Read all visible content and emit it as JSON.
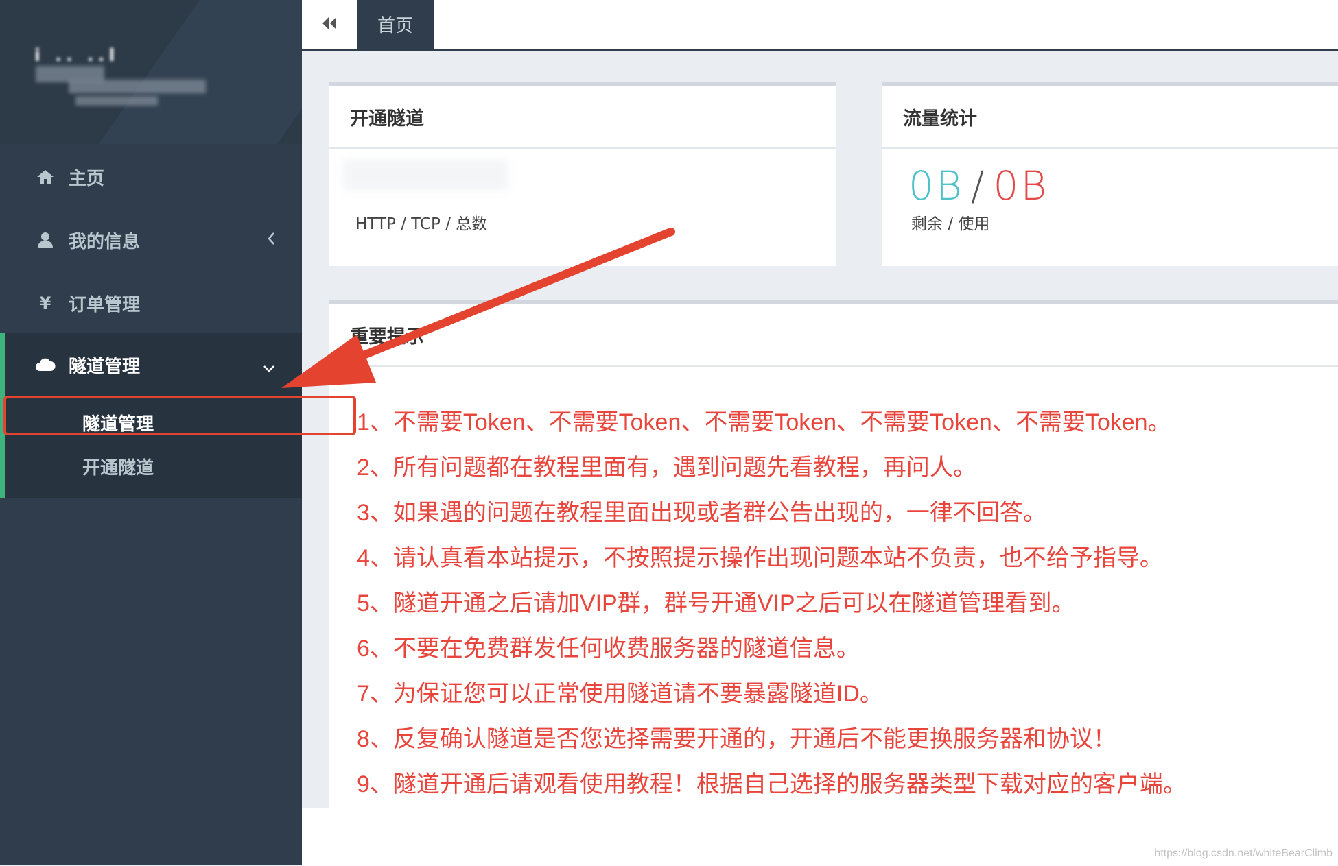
{
  "brand": {
    "text": "i  ..  ..l"
  },
  "sidebar": {
    "items": [
      {
        "label": "主页",
        "icon": "home-icon"
      },
      {
        "label": "我的信息",
        "icon": "user-icon",
        "chevron": "chevron-left-icon"
      },
      {
        "label": "订单管理",
        "icon": "yen-icon",
        "icon_glyph": "¥"
      },
      {
        "label": "隧道管理",
        "icon": "cloud-icon",
        "chevron": "chevron-down-icon"
      }
    ],
    "subitems": [
      {
        "label": "隧道管理"
      },
      {
        "label": "开通隧道"
      }
    ]
  },
  "topbar": {
    "collapse_icon": "double-chevron-left-icon",
    "tab_home": "首页"
  },
  "cards": {
    "tunnel": {
      "title": "开通隧道",
      "caption": "HTTP / TCP / 总数"
    },
    "traffic": {
      "title": "流量统计",
      "remaining": "0B",
      "slash": "/",
      "used": "0B",
      "caption": "剩余 / 使用"
    },
    "notice": {
      "title": "重要提示",
      "lines": [
        "1、不需要Token、不需要Token、不需要Token、不需要Token、不需要Token。",
        "2、所有问题都在教程里面有，遇到问题先看教程，再问人。",
        "3、如果遇的问题在教程里面出现或者群公告出现的，一律不回答。",
        "4、请认真看本站提示，不按照提示操作出现问题本站不负责，也不给予指导。",
        "5、隧道开通之后请加VIP群，群号开通VIP之后可以在隧道管理看到。",
        "6、不要在免费群发任何收费服务器的隧道信息。",
        "7、为保证您可以正常使用隧道请不要暴露隧道ID。",
        "8、反复确认隧道是否您选择需要开通的，开通后不能更换服务器和协议！",
        "9、隧道开通后请观看使用教程！根据自己选择的服务器类型下载对应的客户端。"
      ]
    }
  },
  "colors": {
    "sidebar_bg": "#2f3d4c",
    "active_accent": "#3eb37e",
    "remaining": "#4fc1c9",
    "used": "#e34a4a",
    "notice_text": "#e8453c",
    "annotation": "#e4432f"
  },
  "watermark": "https://blog.csdn.net/whiteBearClimb"
}
